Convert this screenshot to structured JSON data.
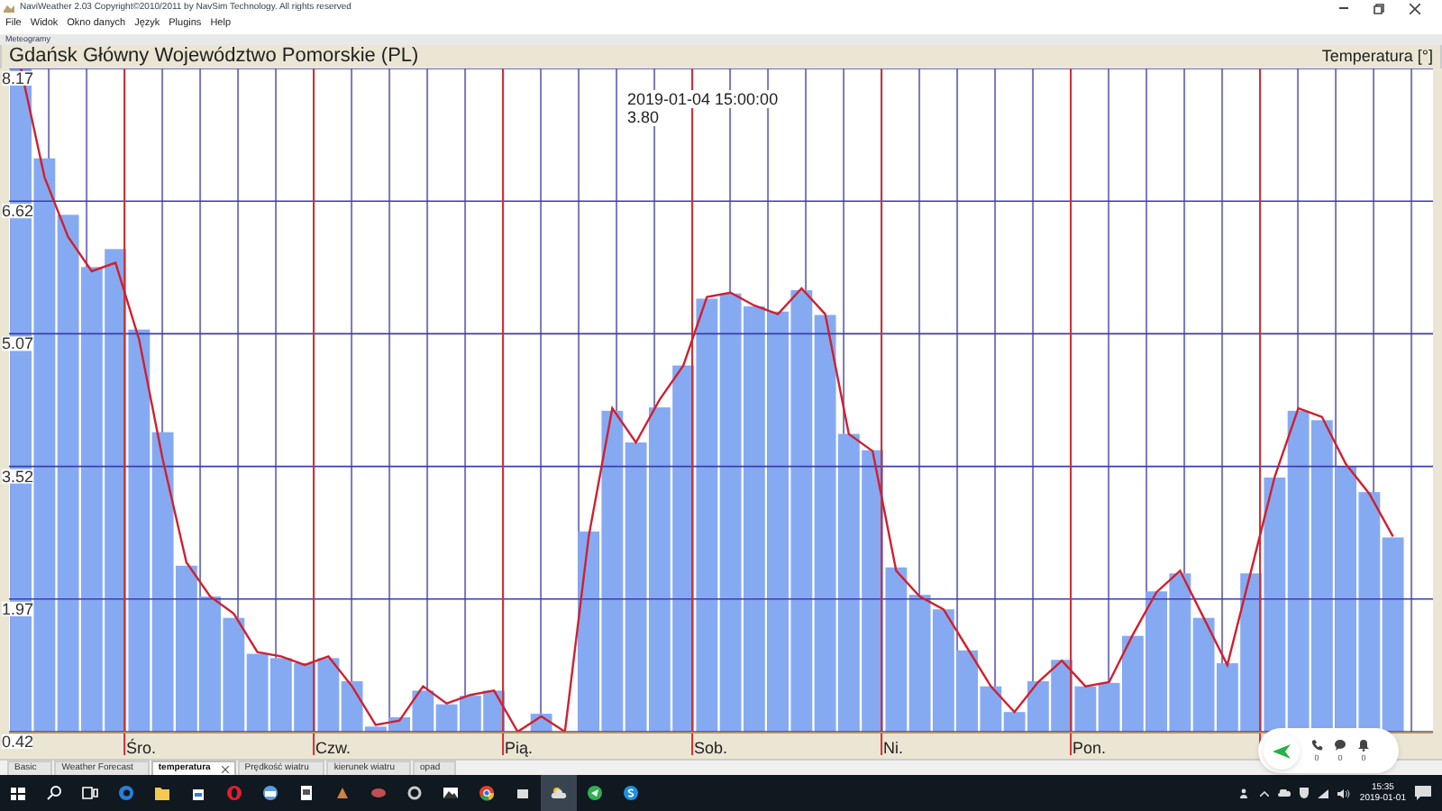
{
  "window": {
    "title": "NaviWeather 2.03 Copyright©2010/2011 by NavSim Technology. All rights reserved"
  },
  "menu": [
    "File",
    "Widok",
    "Okno danych",
    "Język",
    "Plugins",
    "Help"
  ],
  "panel": {
    "label": "Meteogramy",
    "location": "Gdańsk Główny Województwo Pomorskie (PL)",
    "variable": "Temperatura [°]",
    "days": [
      "Śro.",
      "Czw.",
      "Pią.",
      "Sob.",
      "Ni.",
      "Pon."
    ],
    "chart_data": {
      "type": "bar",
      "grid": true,
      "ylim": [
        0.42,
        8.17
      ],
      "yticks": [
        0.42,
        1.97,
        3.52,
        5.07,
        6.62,
        8.17
      ],
      "series": [
        {
          "color": "#86aaf2",
          "values": [
            8.17,
            7.12,
            6.46,
            5.85,
            6.06,
            5.12,
            3.92,
            2.36,
            2.0,
            1.75,
            1.33,
            1.28,
            1.22,
            1.28,
            1.01,
            0.48,
            0.59,
            0.9,
            0.74,
            0.84,
            0.9,
            0.42,
            0.63,
            0.42,
            2.76,
            4.17,
            3.8,
            4.21,
            4.7,
            5.48,
            5.54,
            5.39,
            5.33,
            5.58,
            5.29,
            3.9,
            3.71,
            2.34,
            2.02,
            1.85,
            1.37,
            0.95,
            0.65,
            1.01,
            1.26,
            0.95,
            0.99,
            1.54,
            2.06,
            2.27,
            1.75,
            1.22,
            2.27,
            3.39,
            4.17,
            4.06,
            3.52,
            3.22,
            2.69
          ]
        },
        {
          "type": "line",
          "color": "#d02030",
          "values": [
            8.17,
            6.9,
            6.2,
            5.8,
            5.9,
            5.0,
            3.6,
            2.4,
            2.0,
            1.8,
            1.35,
            1.3,
            1.2,
            1.3,
            0.95,
            0.5,
            0.55,
            0.95,
            0.75,
            0.85,
            0.9,
            0.42,
            0.6,
            0.42,
            2.7,
            4.2,
            3.8,
            4.3,
            4.7,
            5.5,
            5.55,
            5.4,
            5.3,
            5.6,
            5.3,
            3.9,
            3.7,
            2.3,
            2.0,
            1.85,
            1.4,
            0.95,
            0.65,
            1.0,
            1.25,
            0.95,
            1.0,
            1.55,
            2.05,
            2.3,
            1.75,
            1.2,
            2.3,
            3.4,
            4.2,
            4.1,
            3.55,
            3.2,
            2.7
          ]
        }
      ],
      "annotations": [
        "2019-01-04 15:00:00",
        "3.80"
      ]
    }
  },
  "tabs": [
    {
      "label": "Basic",
      "selected": false,
      "closable": false
    },
    {
      "label": "Weather Forecast",
      "selected": false,
      "closable": false
    },
    {
      "label": "temperatura",
      "selected": true,
      "closable": true
    },
    {
      "label": "Prędkość wiatru",
      "selected": false,
      "closable": false
    },
    {
      "label": "kierunek wiatru",
      "selected": false,
      "closable": false
    },
    {
      "label": "opad",
      "selected": false,
      "closable": false
    }
  ],
  "widget": {
    "counters": [
      {
        "kind": "phone",
        "count": "0"
      },
      {
        "kind": "chat",
        "count": "0"
      },
      {
        "kind": "bell",
        "count": "0"
      }
    ]
  },
  "taskbar": {
    "time": "15:35",
    "date": "2019-01-01"
  }
}
